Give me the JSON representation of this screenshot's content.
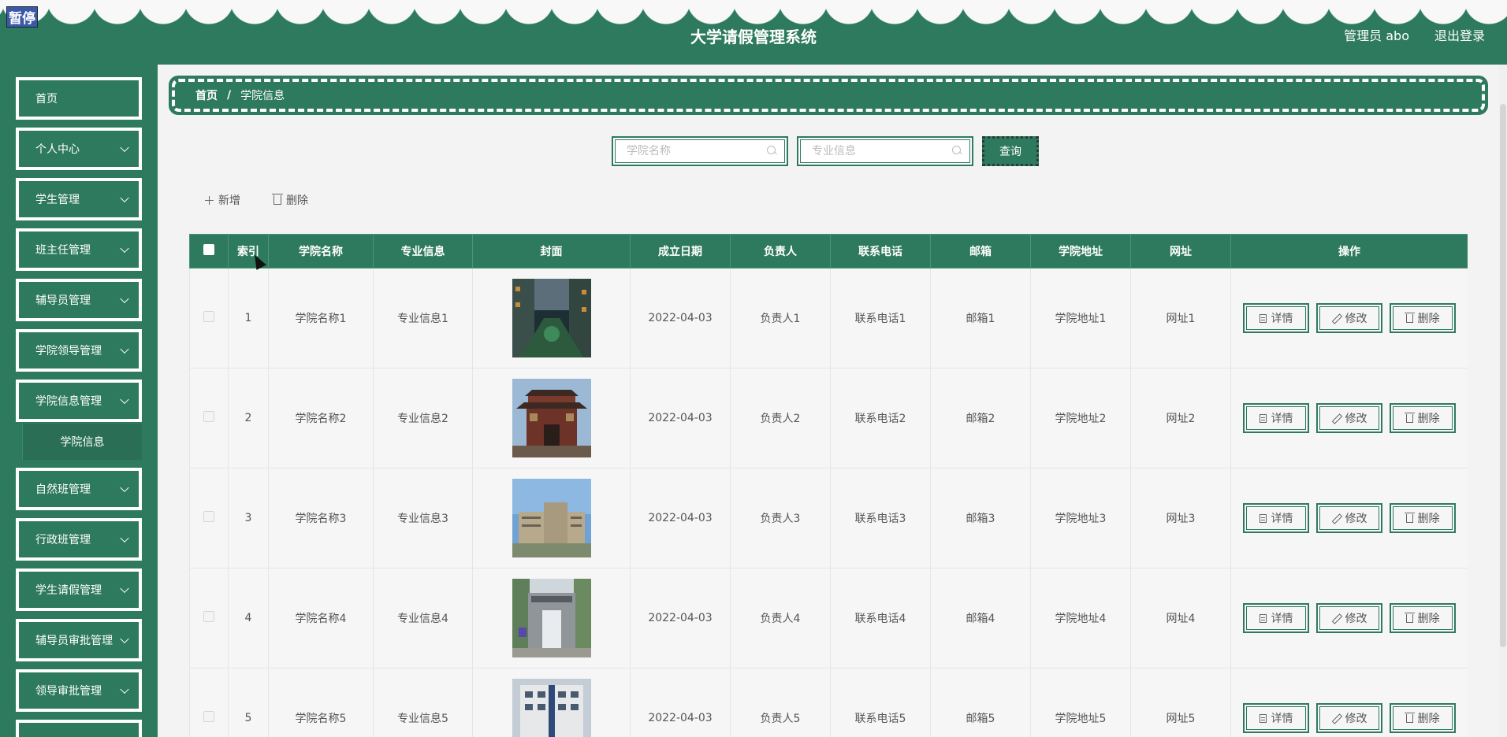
{
  "header": {
    "pause_badge": "暂停",
    "app_title": "大学请假管理系统",
    "user_label": "管理员 abo",
    "logout_label": "退出登录"
  },
  "sidebar": {
    "items": [
      {
        "label": "首页"
      },
      {
        "label": "个人中心"
      },
      {
        "label": "学生管理"
      },
      {
        "label": "班主任管理"
      },
      {
        "label": "辅导员管理"
      },
      {
        "label": "学院领导管理"
      },
      {
        "label": "学院信息管理"
      },
      {
        "label": "自然班管理"
      },
      {
        "label": "行政班管理"
      },
      {
        "label": "学生请假管理"
      },
      {
        "label": "辅导员审批管理"
      },
      {
        "label": "领导审批管理"
      }
    ],
    "active_sub": "学院信息"
  },
  "breadcrumb": {
    "home": "首页",
    "separator": "/",
    "current": "学院信息"
  },
  "search": {
    "college_placeholder": "学院名称",
    "major_placeholder": "专业信息",
    "query_label": "查询"
  },
  "actions": {
    "add_label": "新增",
    "delete_label": "删除"
  },
  "table": {
    "headers": [
      "索引",
      "学院名称",
      "专业信息",
      "封面",
      "成立日期",
      "负责人",
      "联系电话",
      "邮箱",
      "学院地址",
      "网址",
      "操作"
    ],
    "op_labels": {
      "detail": "详情",
      "edit": "修改",
      "delete": "删除"
    },
    "rows": [
      {
        "index": "1",
        "name": "学院名称1",
        "major": "专业信息1",
        "date": "2022-04-03",
        "leader": "负责人1",
        "phone": "联系电话1",
        "email": "邮箱1",
        "address": "学院地址1",
        "url": "网址1"
      },
      {
        "index": "2",
        "name": "学院名称2",
        "major": "专业信息2",
        "date": "2022-04-03",
        "leader": "负责人2",
        "phone": "联系电话2",
        "email": "邮箱2",
        "address": "学院地址2",
        "url": "网址2"
      },
      {
        "index": "3",
        "name": "学院名称3",
        "major": "专业信息3",
        "date": "2022-04-03",
        "leader": "负责人3",
        "phone": "联系电话3",
        "email": "邮箱3",
        "address": "学院地址3",
        "url": "网址3"
      },
      {
        "index": "4",
        "name": "学院名称4",
        "major": "专业信息4",
        "date": "2022-04-03",
        "leader": "负责人4",
        "phone": "联系电话4",
        "email": "邮箱4",
        "address": "学院地址4",
        "url": "网址4"
      },
      {
        "index": "5",
        "name": "学院名称5",
        "major": "专业信息5",
        "date": "2022-04-03",
        "leader": "负责人5",
        "phone": "联系电话5",
        "email": "邮箱5",
        "address": "学院地址5",
        "url": "网址5"
      }
    ]
  },
  "colors": {
    "primary": "#2e7a5e",
    "background": "#f3f3f3"
  }
}
